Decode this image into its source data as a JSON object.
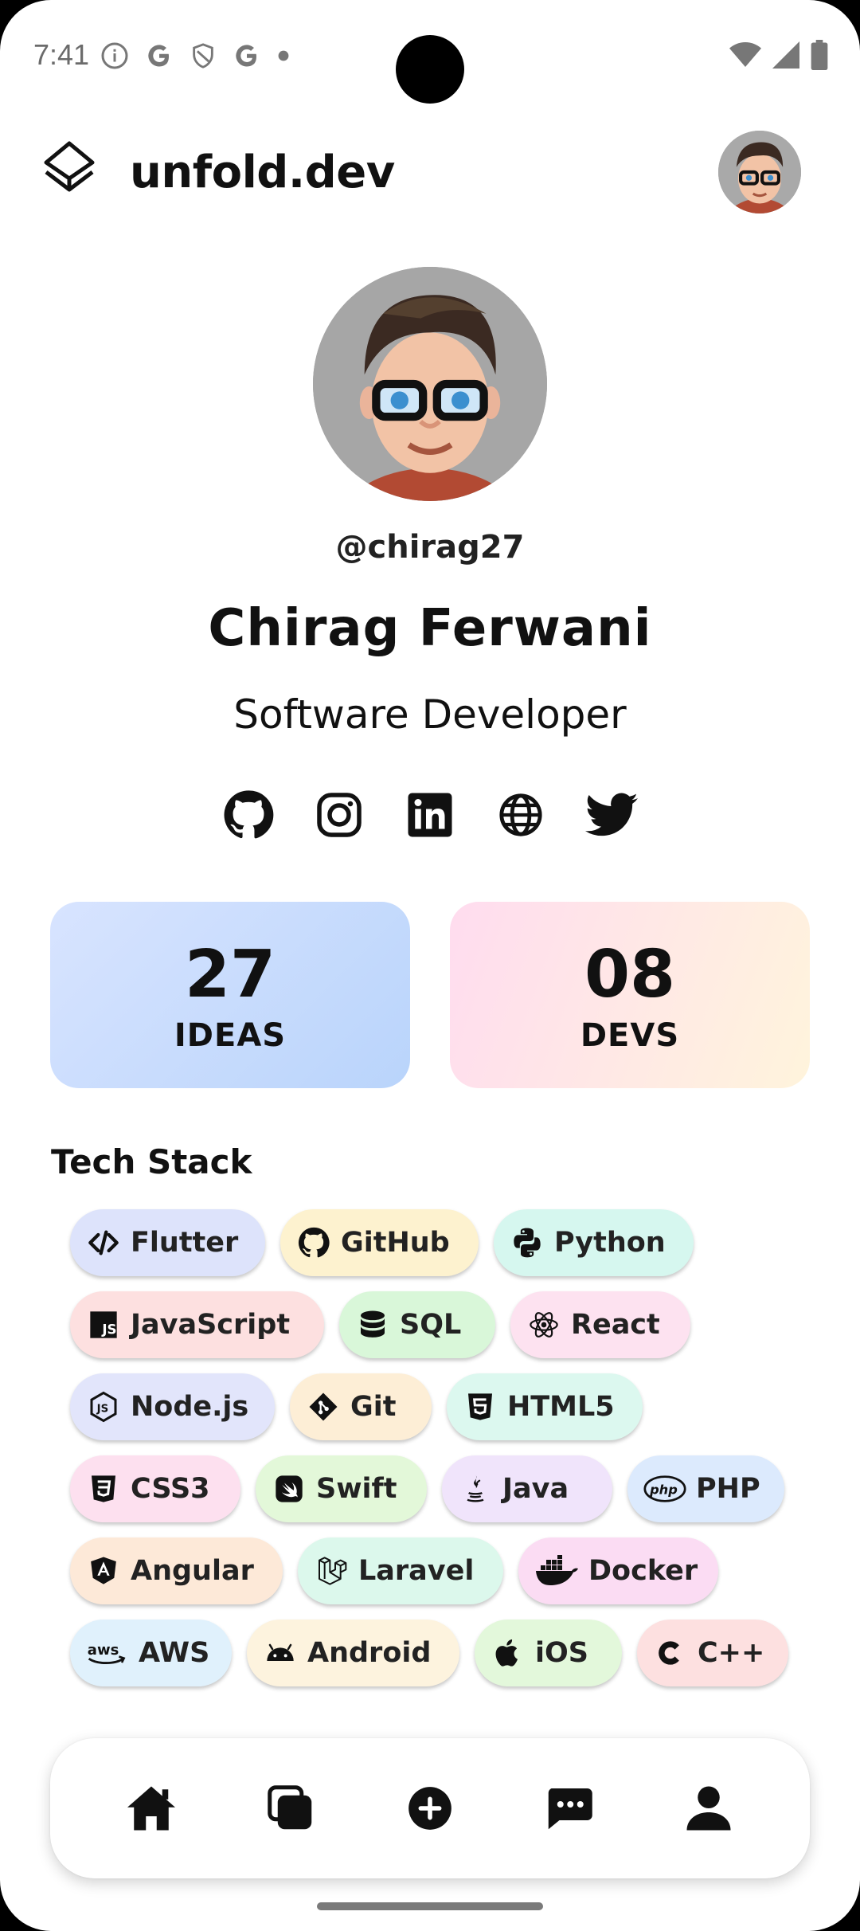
{
  "status_bar": {
    "time": "7:41"
  },
  "header": {
    "brand": "unfold.dev"
  },
  "profile": {
    "handle": "@chirag27",
    "name": "Chirag Ferwani",
    "role": "Software Developer"
  },
  "socials": [
    "github-icon",
    "instagram-icon",
    "linkedin-icon",
    "globe-icon",
    "twitter-icon"
  ],
  "stats": [
    {
      "value": "27",
      "label": "IDEAS"
    },
    {
      "value": "08",
      "label": "DEVS"
    }
  ],
  "tech_stack": {
    "title": "Tech Stack",
    "chips": [
      {
        "label": "Flutter",
        "color": "#dde3fb"
      },
      {
        "label": "GitHub",
        "color": "#fdf2cf"
      },
      {
        "label": "Python",
        "color": "#d6f7ef"
      },
      {
        "label": "JavaScript",
        "color": "#fde0e0"
      },
      {
        "label": "SQL",
        "color": "#d9f7d9"
      },
      {
        "label": "React",
        "color": "#fde2f0"
      },
      {
        "label": "Node.js",
        "color": "#e2e5fb"
      },
      {
        "label": "Git",
        "color": "#fdeed6"
      },
      {
        "label": "HTML5",
        "color": "#dcf8ef"
      },
      {
        "label": "CSS3",
        "color": "#fde0ef"
      },
      {
        "label": "Swift",
        "color": "#e3f8d9"
      },
      {
        "label": "Java",
        "color": "#f0e4fb"
      },
      {
        "label": "PHP",
        "color": "#dceafd"
      },
      {
        "label": "Angular",
        "color": "#fde9d8"
      },
      {
        "label": "Laravel",
        "color": "#dcf8ec"
      },
      {
        "label": "Docker",
        "color": "#fbdcf3"
      },
      {
        "label": "AWS",
        "color": "#e0f1fc"
      },
      {
        "label": "Android",
        "color": "#fdf3de"
      },
      {
        "label": "iOS",
        "color": "#e3f8db"
      },
      {
        "label": "C++",
        "color": "#fde0e0"
      }
    ]
  },
  "nav": [
    "home-icon",
    "collections-icon",
    "add-icon",
    "chat-icon",
    "profile-icon"
  ]
}
